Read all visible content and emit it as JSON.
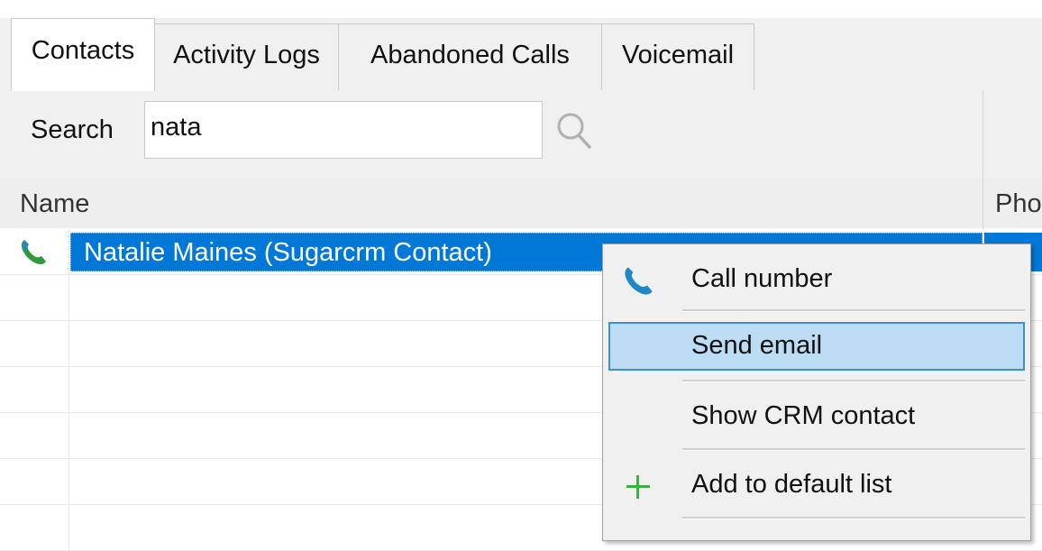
{
  "tabs": [
    {
      "label": "Contacts",
      "active": true
    },
    {
      "label": "Activity Logs",
      "active": false
    },
    {
      "label": "Abandoned Calls",
      "active": false
    },
    {
      "label": "Voicemail",
      "active": false
    }
  ],
  "search": {
    "label": "Search",
    "value": "nata"
  },
  "table": {
    "columns": {
      "name": "Name",
      "phone": "Pho"
    },
    "rows": [
      {
        "name": "Natalie Maines (Sugarcrm Contact)",
        "selected": true
      }
    ]
  },
  "context_menu": {
    "items": [
      {
        "label": "Call number",
        "icon": "phone-icon"
      },
      {
        "label": "Send email",
        "icon": "",
        "hovered": true
      },
      {
        "label": "Show CRM contact",
        "icon": ""
      },
      {
        "label": "Add to default list",
        "icon": "plus-icon"
      }
    ]
  },
  "colors": {
    "selection": "#0078d7",
    "menu_hover": "#bcdcf4",
    "phone_icon_blue": "#1e88c8",
    "phone_icon_green": "#2e9b3a",
    "plus_green": "#3cb043"
  }
}
